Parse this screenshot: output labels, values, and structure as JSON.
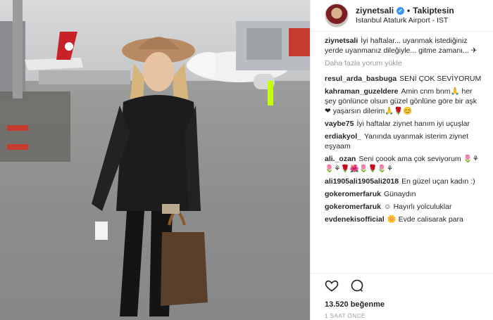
{
  "post": {
    "username": "ziynetsali",
    "follow_status": "Takiptesin",
    "dot": "•",
    "location": "Istanbul Ataturk Airport - IST",
    "likes": "13.520 beğenme",
    "time_ago": "1 SAAT ÖNCE",
    "load_more": "Daha fazla yorum yükle"
  },
  "caption": {
    "user": "ziynetsali",
    "text": "İyi haftalar... uyanmak istediğiniz yerde uyanmanız dileğiyle... gitme zamanı... ✈"
  },
  "comments": [
    {
      "user": "resul_arda_basbuga",
      "text": "SENİ ÇOK SEVİYORUM"
    },
    {
      "user": "kahraman_guzeldere",
      "text": "Amin cnm bnm🙏 her şey gönlünce olsun güzel gönlüne göre bir aşk ❤ yaşarsın dilerim🙏🌹😊"
    },
    {
      "user": "vaybe75",
      "text": "İyi haftalar ziynet hanım iyi uçuşlar"
    },
    {
      "user": "erdiakyol_",
      "text": "Yanında uyanmak isterim ziynet eşyaam"
    },
    {
      "user": "ali._ozan",
      "text": "Seni çoook ama çok seviyorum 🌷⚘🌷⚘🌹🌺🌷🌹🌷⚘"
    },
    {
      "user": "ali1905ali1905ali2018",
      "text": "En güzel uçan kadın :)"
    },
    {
      "user": "gokeromerfaruk",
      "text": "Günaydın"
    },
    {
      "user": "gokeromerfaruk",
      "text": "☺ Hayırlı yolculuklar"
    },
    {
      "user": "evdenekisofficial",
      "text": "🌼 Evde calisarak para"
    }
  ],
  "icons": {
    "like": "heart-icon",
    "comment": "comment-icon"
  },
  "colors": {
    "verified": "#3897f0",
    "border": "#efefef",
    "muted": "#999999"
  }
}
